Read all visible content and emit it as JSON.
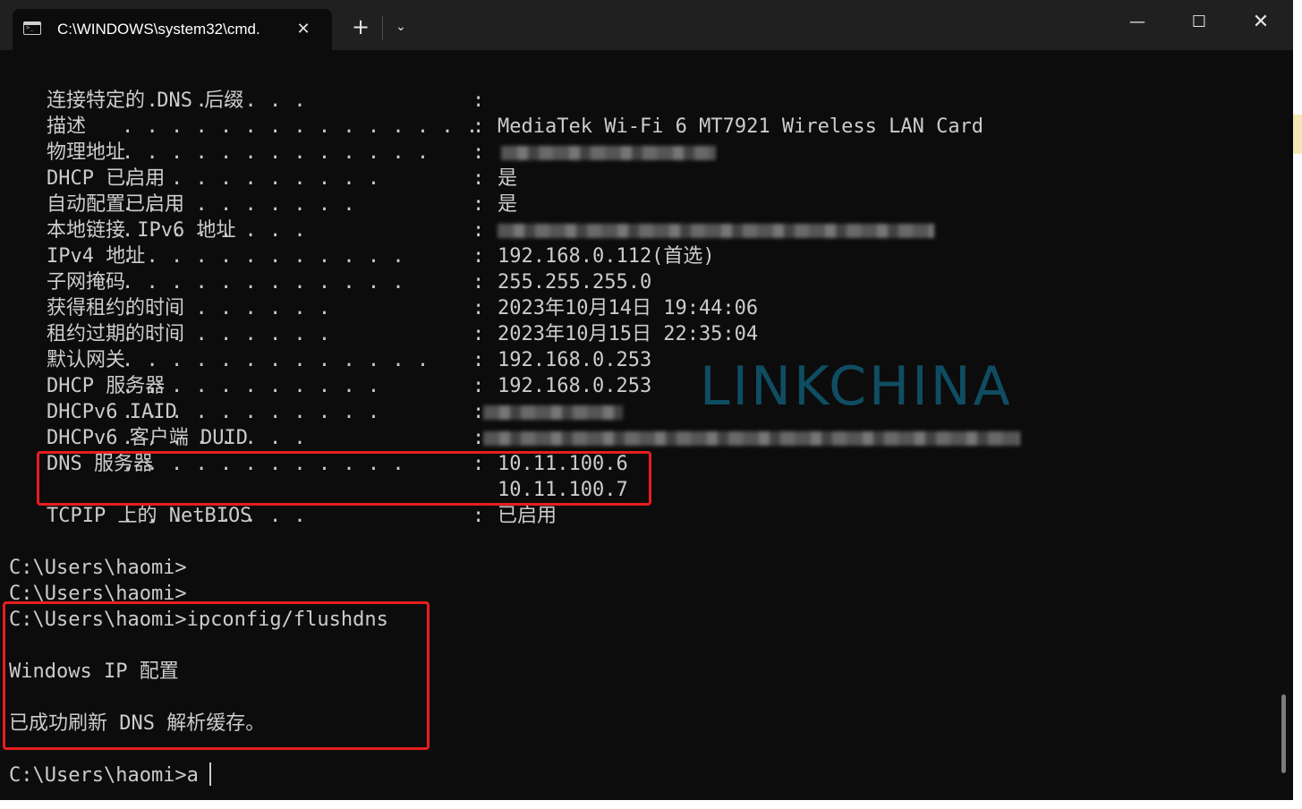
{
  "window": {
    "tab_title": "C:\\WINDOWS\\system32\\cmd.",
    "tab_close": "✕",
    "new_tab": "+",
    "dropdown": "⌄",
    "minimize": "—",
    "maximize": "☐",
    "close": "✕"
  },
  "adapter_rows": [
    {
      "label": "连接特定的 DNS 后缀",
      "dots": ". . . . . . . .",
      "colon": ":",
      "value": ""
    },
    {
      "label": "描述",
      "dots": ". . . . . . . . . . . . . . .",
      "colon": ":",
      "value": "MediaTek Wi-Fi 6 MT7921 Wireless LAN Card"
    },
    {
      "label": "物理地址",
      "dots": ". . . . . . . . . . . . .",
      "colon": ":",
      "value": ""
    },
    {
      "label": "DHCP 已启用",
      "dots": ". . . . . . . . . . .",
      "colon": ":",
      "value": "是"
    },
    {
      "label": "自动配置已启用",
      "dots": ". . . . . . . . . .",
      "colon": ":",
      "value": "是"
    },
    {
      "label": "本地链接 IPv6 地址",
      "dots": ". . . . . . . .",
      "colon": ":",
      "value": ""
    },
    {
      "label": "IPv4 地址",
      "dots": ". . . . . . . . . . . .",
      "colon": ":",
      "value": "192.168.0.112(首选)"
    },
    {
      "label": "子网掩码",
      "dots": ". . . . . . . . . . . .",
      "colon": ":",
      "value": "255.255.255.0"
    },
    {
      "label": "获得租约的时间",
      "dots": ". . . . . . . . .",
      "colon": ":",
      "value": "2023年10月14日 19:44:06"
    },
    {
      "label": "租约过期的时间",
      "dots": ". . . . . . . . .",
      "colon": ":",
      "value": "2023年10月15日 22:35:04"
    },
    {
      "label": "默认网关",
      "dots": ". . . . . . . . . . . . .",
      "colon": ":",
      "value": "192.168.0.253"
    },
    {
      "label": "DHCP 服务器",
      "dots": ". . . . . . . . . . .",
      "colon": ":",
      "value": "192.168.0.253"
    },
    {
      "label": "DHCPv6 IAID",
      "dots": ". . . . . . . . . . .",
      "colon": ":",
      "value": ""
    },
    {
      "label": "DHCPv6 客户端 DUID",
      "dots": ". . . . . . . .",
      "colon": ":",
      "value": ""
    },
    {
      "label": "DNS 服务器",
      "dots": ". . . . . . . . . . . .",
      "colon": ":",
      "value": "10.11.100.6"
    },
    {
      "label": "",
      "dots": "",
      "colon": "",
      "value": "10.11.100.7"
    },
    {
      "label": "TCPIP 上的 NetBIOS",
      "dots": ". . . . . . . .",
      "colon": ":",
      "value": "已启用"
    }
  ],
  "console": {
    "prompt_1": "C:\\Users\\haomi>",
    "prompt_2": "C:\\Users\\haomi>",
    "command": "C:\\Users\\haomi>ipconfig/flushdns",
    "header": "Windows IP 配置",
    "result": "已成功刷新 DNS 解析缓存。",
    "current_prompt": "C:\\Users\\haomi>a"
  },
  "watermark": "LINKCHINA",
  "colors": {
    "terminal_bg": "#0c0c0c",
    "titlebar_bg": "#202020",
    "text": "#cccccc",
    "highlight": "#e81e1e",
    "watermark": "#0f4d62"
  }
}
